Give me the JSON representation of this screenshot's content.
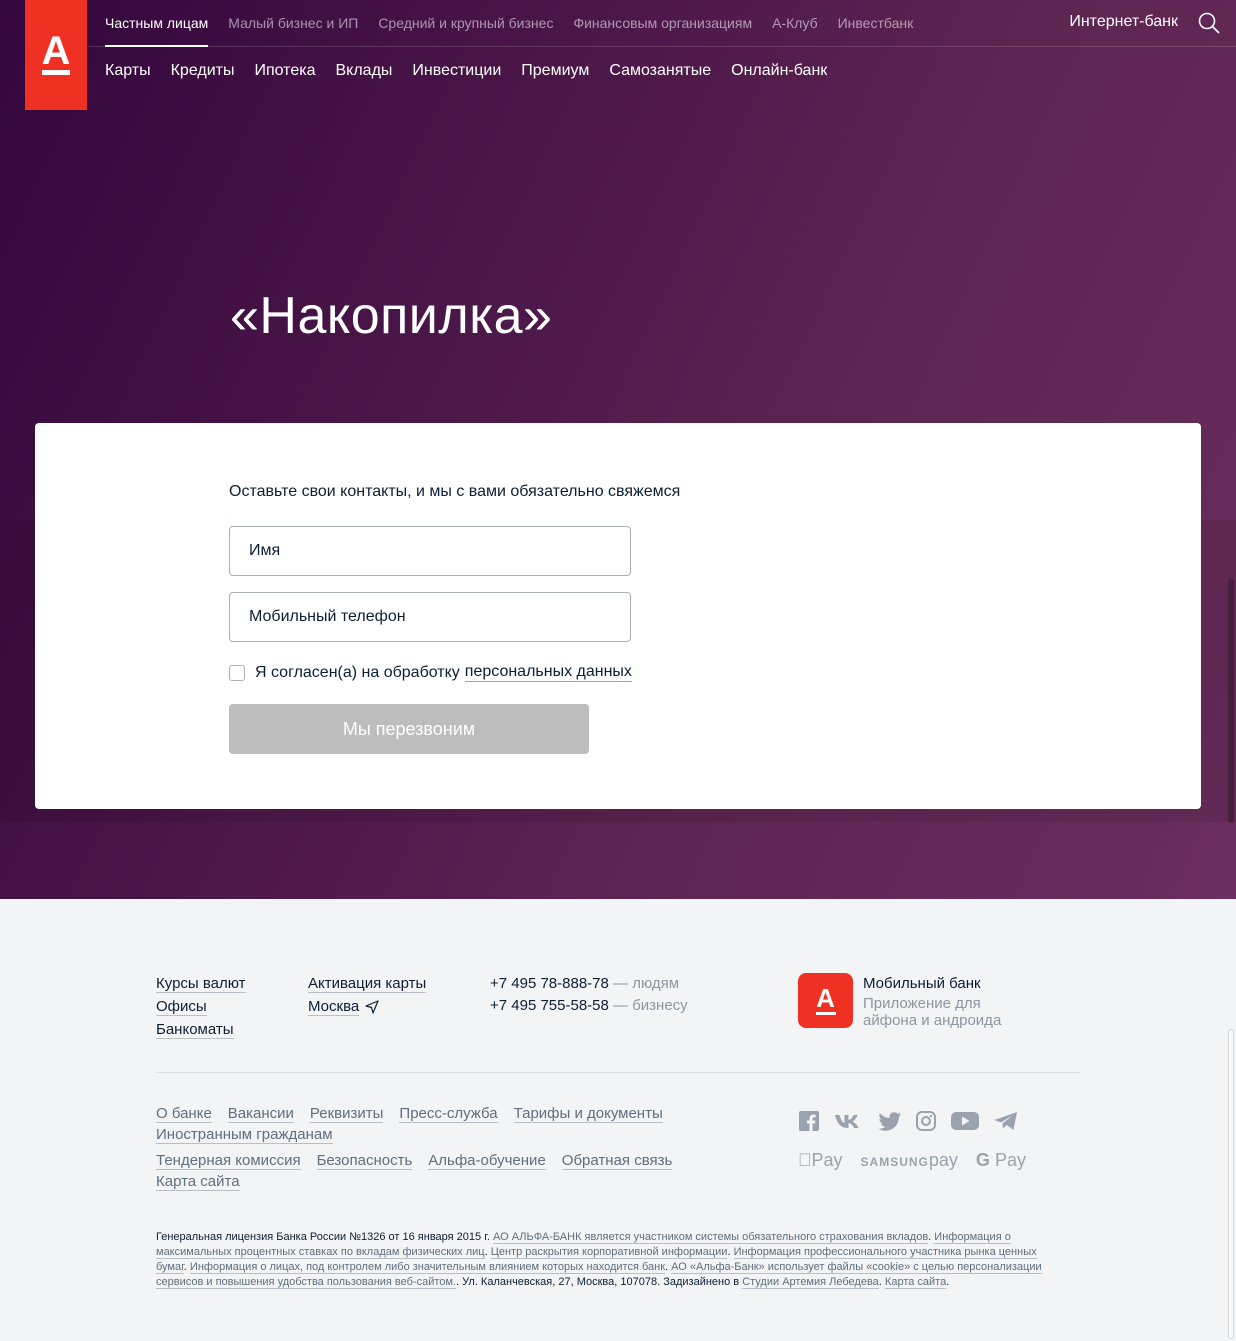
{
  "header": {
    "top_nav": [
      "Частным лицам",
      "Малый бизнес и ИП",
      "Средний и крупный бизнес",
      "Финансовым организациям",
      "А-Клуб",
      "Инвестбанк"
    ],
    "internet_bank": "Интернет-банк",
    "sub_nav": [
      "Карты",
      "Кредиты",
      "Ипотека",
      "Вклады",
      "Инвестиции",
      "Премиум",
      "Самозанятые",
      "Онлайн-банк"
    ]
  },
  "logo_letter": "А",
  "hero": {
    "title": "«Накопилка»"
  },
  "form": {
    "hint": "Оставьте свои контакты, и мы с вами обязательно свяжемся",
    "name_placeholder": "Имя",
    "phone_placeholder": "Мобильный телефон",
    "consent_text": "Я согласен(а) на обработку",
    "consent_link": "персональных данных",
    "submit_label": "Мы перезвоним"
  },
  "footer": {
    "col1": [
      "Курсы валют",
      "Офисы",
      "Банкоматы"
    ],
    "col2_activation": "Активация карты",
    "col2_city": "Москва",
    "phones": [
      {
        "number": "+7 495 78-888-78",
        "desc": " — людям"
      },
      {
        "number": "+7 495 755-58-58",
        "desc": " — бизнесу"
      }
    ],
    "mobile_bank_title": "Мобильный банк",
    "mobile_bank_desc": "Приложение для айфона и андроида",
    "links_row1": [
      "О банке",
      "Вакансии",
      "Реквизиты",
      "Пресс-служба",
      "Тарифы и документы"
    ],
    "links_row2": [
      "Иностранным гражданам"
    ],
    "links_row3": [
      "Тендерная комиссия",
      "Безопасность",
      "Альфа-обучение",
      "Обратная связь"
    ],
    "links_row4": [
      "Карта сайта"
    ],
    "pay": {
      "apple": "Pay",
      "samsung_prefix": "SAMSUNG",
      "samsung_suffix": "pay",
      "google": "Pay"
    },
    "legal": {
      "t1": "Генеральная лицензия Банка России №1326 от 16 января 2015 г. ",
      "l1": "АО АЛЬФА-БАНК является участником системы обязательного страхования вкладов",
      "t2": ". ",
      "l2": "Информация о максимальных процентных ставках по вкладам физических лиц",
      "t3": ". ",
      "l3": "Центр раскрытия корпоративной информации",
      "t4": ". ",
      "l4": "Информация профессионального участника рынка ценных бумаг",
      "t5": ". ",
      "l5": "Информация о лицах, под контролем либо значительным влиянием которых находится банк",
      "t6": ". ",
      "l6": "АО «Альфа-Банк» использует файлы «cookie» с целью персонализации сервисов и повышения удобства пользования веб-сайтом.",
      "t7": ". Ул. Каланчевская, 27, Москва, 107078. Задизайнено в ",
      "l7": "Студии Артемия Лебедева",
      "t8": ". ",
      "l8": "Карта сайта",
      "t9": "."
    }
  },
  "colors": {
    "brand_red": "#ef3124",
    "hero_dark": "#33063d",
    "hero_light": "#6b2e5e",
    "button_disabled": "#bdbdbd"
  }
}
